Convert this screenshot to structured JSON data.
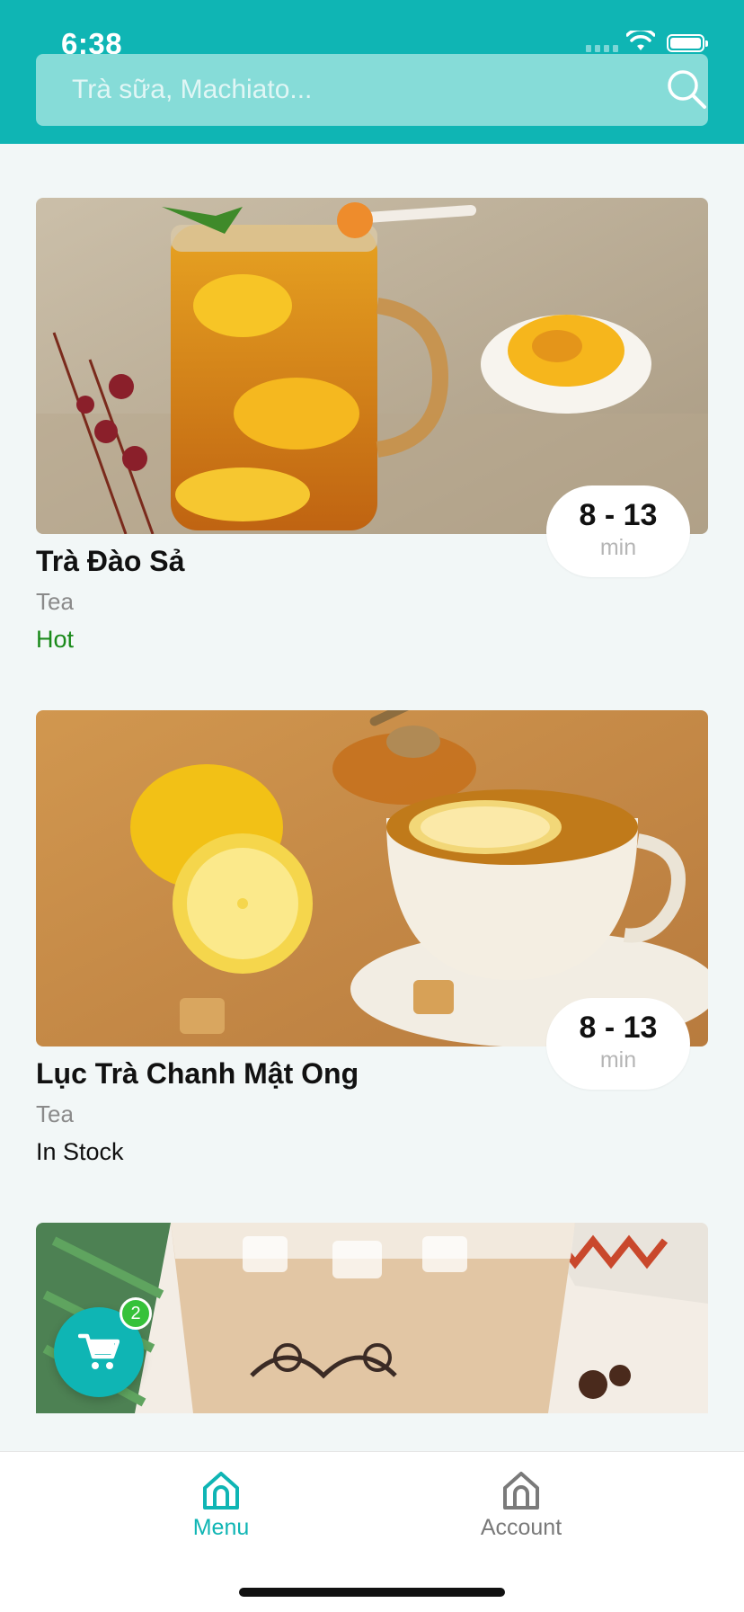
{
  "status_bar": {
    "time": "6:38"
  },
  "search": {
    "placeholder": "Trà sữa, Machiato...",
    "value": ""
  },
  "menu_items": [
    {
      "name": "Trà Đào Sả",
      "category": "Tea",
      "status": "Hot",
      "status_color": "#1a8a1a",
      "time_range": "8 - 13",
      "time_unit": "min"
    },
    {
      "name": "Lục Trà Chanh Mật Ong",
      "category": "Tea",
      "status": "In Stock",
      "status_color": "#111111",
      "time_range": "8 - 13",
      "time_unit": "min"
    },
    {
      "name": "",
      "category": "",
      "status": "",
      "time_range": "",
      "time_unit": ""
    }
  ],
  "cart": {
    "count": "2",
    "icon": "cart-icon"
  },
  "tabbar": {
    "tabs": [
      {
        "label": "Menu",
        "icon": "home-icon",
        "active": true
      },
      {
        "label": "Account",
        "icon": "home-icon",
        "active": false
      }
    ]
  },
  "colors": {
    "accent": "#0fb5b4",
    "search_bg": "#86dcd8",
    "page_bg": "#f2f7f7",
    "hot_status": "#1a8a1a",
    "cart_badge": "#36c23a",
    "inactive_tab": "#7a7a7a"
  }
}
